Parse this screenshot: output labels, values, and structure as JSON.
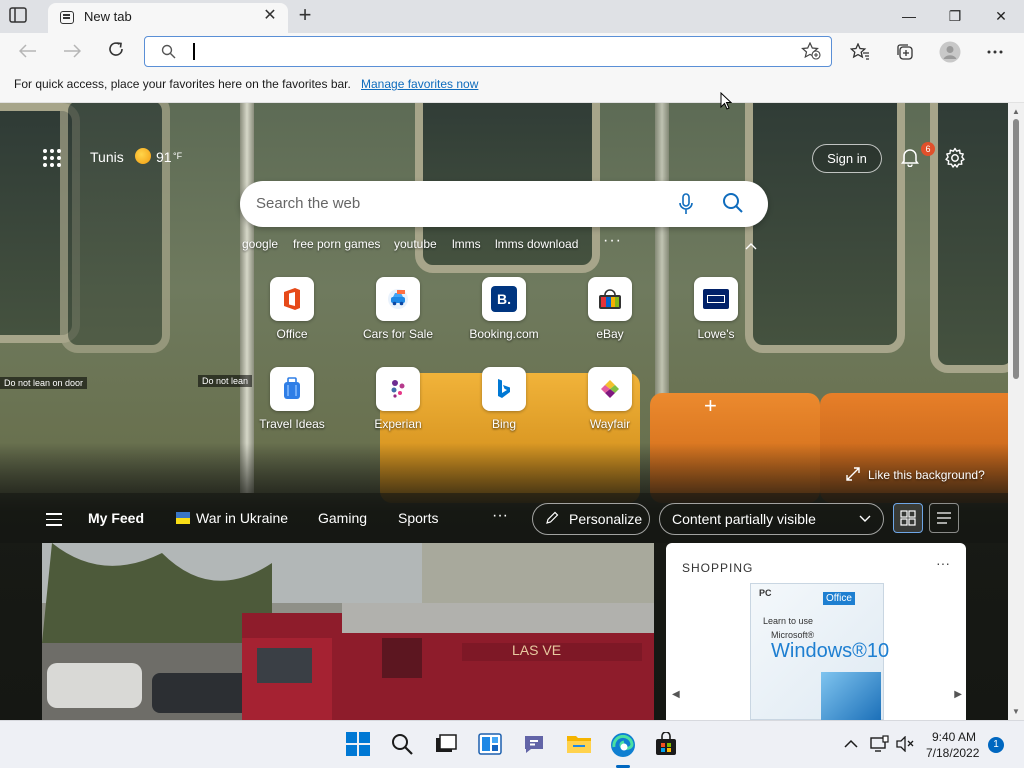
{
  "browser": {
    "tab_title": "New tab",
    "new_tab_symbol": "+",
    "close_symbol": "✕",
    "window_controls": {
      "minimize": "—",
      "restore": "❐",
      "close": "✕"
    }
  },
  "toolbar": {
    "address_value": "",
    "address_placeholder": ""
  },
  "favorites_bar": {
    "message": "For quick access, place your favorites here on the favorites bar.",
    "link": "Manage favorites now"
  },
  "newtab": {
    "weather": {
      "city": "Tunis",
      "temp": "91",
      "unit": "°F",
      "icon": "sun-icon"
    },
    "sign_in": "Sign in",
    "notifications_count": "6",
    "search_placeholder": "Search the web",
    "trending": [
      "google",
      "free porn games",
      "youtube",
      "lmms",
      "lmms download"
    ],
    "trending_more": "···",
    "quick_links_row1": [
      {
        "label": "Office",
        "icon": "office-icon",
        "color": "#e64a19"
      },
      {
        "label": "Cars for Sale",
        "icon": "car-icon",
        "color": "#1e88e5"
      },
      {
        "label": "Booking.com",
        "icon": "booking-icon",
        "color": "#003580"
      },
      {
        "label": "eBay",
        "icon": "ebay-icon",
        "color": "#0064d2"
      },
      {
        "label": "Lowe's",
        "icon": "lowes-icon",
        "color": "#012169"
      }
    ],
    "quick_links_row2": [
      {
        "label": "Travel Ideas",
        "icon": "suitcase-icon",
        "color": "#2f7ee6"
      },
      {
        "label": "Experian",
        "icon": "experian-icon",
        "color": "#6d2c91"
      },
      {
        "label": "Bing",
        "icon": "bing-icon",
        "color": "#0078d4"
      },
      {
        "label": "Wayfair",
        "icon": "wayfair-icon",
        "color": "#7f187f"
      }
    ],
    "add_shortcut": "+",
    "sign_left": "Do not lean on door",
    "sign_mid": "Do not lean",
    "like_background": "Like this background?",
    "feed": {
      "items": [
        "My Feed",
        "War in Ukraine",
        "Gaming",
        "Sports"
      ],
      "more": "···",
      "personalize": "Personalize",
      "visibility": "Content partially visible"
    },
    "shopping": {
      "header": "SHOPPING",
      "more": "···",
      "product_brand": "PC",
      "product_tag": "Office",
      "product_line1": "Learn to use",
      "product_line2": "Microsoft®",
      "product_line3": "Windows®10"
    }
  },
  "taskbar": {
    "time": "9:40 AM",
    "date": "7/18/2022",
    "notification_count": "1"
  }
}
